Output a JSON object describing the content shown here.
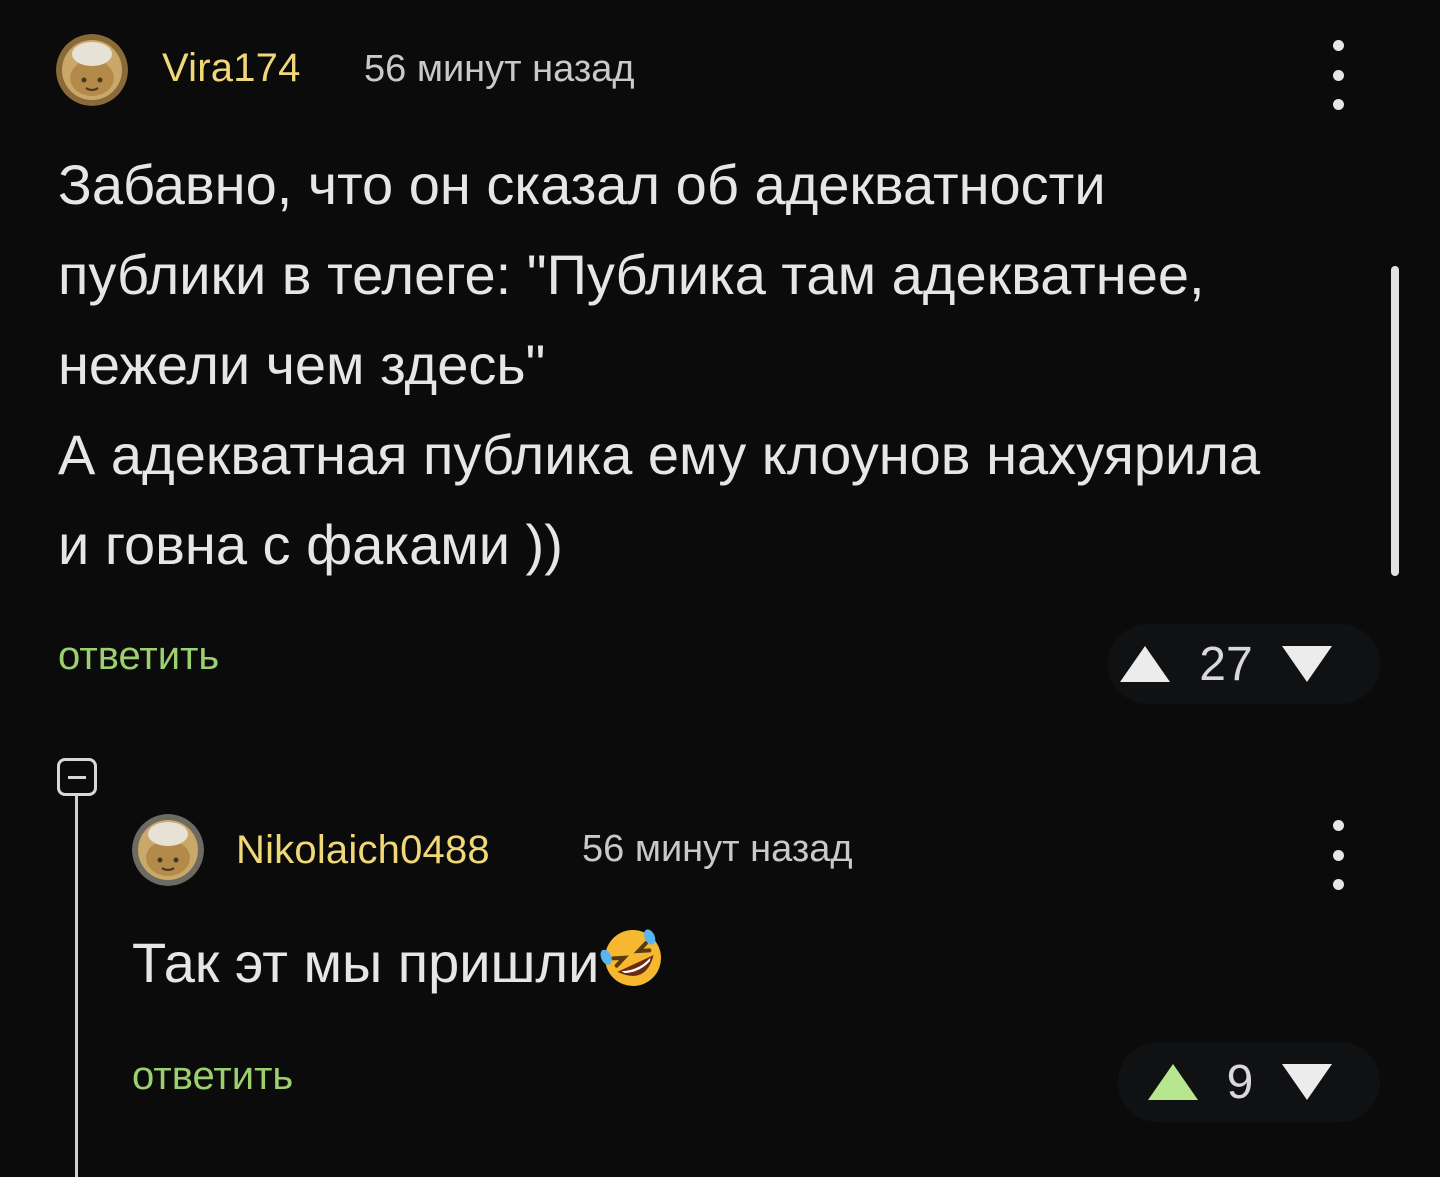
{
  "comment1": {
    "username": "Vira174",
    "time": "56 минут назад",
    "lines": [
      "Забавно, что он сказал об адекватности",
      "публики в телеге: \"Публика там адекватнее,",
      "нежели чем здесь\"",
      "А адекватная публика ему клоунов нахуярила",
      "и говна с факами ))"
    ],
    "reply_label": "ответить",
    "rating": "27",
    "upvoted": false,
    "avatar_icon": "cook-hat-avatar-icon",
    "menu_icon": "kebab-menu-icon"
  },
  "comment2": {
    "username": "Nikolaich0488",
    "time": "56 минут назад",
    "text": "Так эт мы пришли",
    "emoji": "🤣",
    "reply_label": "ответить",
    "rating": "9",
    "upvoted": true,
    "avatar_icon": "cook-hat-avatar-icon",
    "menu_icon": "kebab-menu-icon"
  },
  "thread": {
    "collapse_icon": "minus-box-icon"
  },
  "colors": {
    "background": "#0b0b0c",
    "username": "#f0d879",
    "reply": "#9ccf6d",
    "upvote_active": "#b8e68f",
    "text": "#e6e6e8"
  }
}
